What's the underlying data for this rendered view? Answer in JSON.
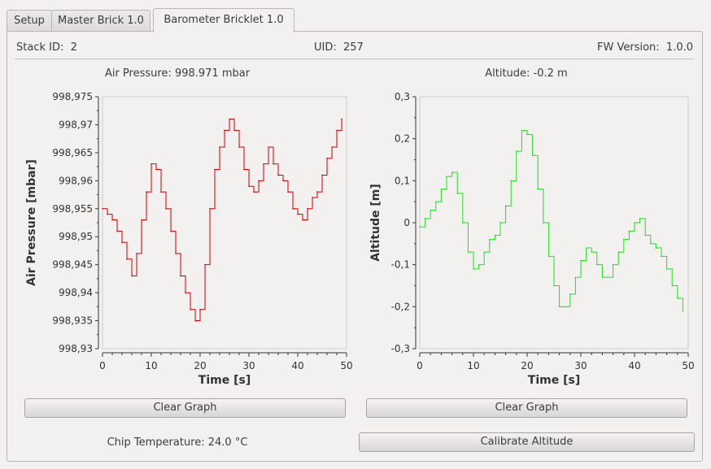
{
  "tabs": [
    {
      "label": "Setup",
      "active": false
    },
    {
      "label": "Master Brick 1.0",
      "active": false
    },
    {
      "label": "Barometer Bricklet 1.0",
      "active": true
    }
  ],
  "info": {
    "stack_id_label": "Stack ID:",
    "stack_id_value": "2",
    "uid_label": "UID:",
    "uid_value": "257",
    "fw_label": "FW Version:",
    "fw_value": "1.0.0"
  },
  "air_pressure_text": "Air Pressure: 998.971 mbar",
  "altitude_text": "Altitude: -0.2 m",
  "chip_temperature_text": "Chip Temperature: 24.0 °C",
  "buttons": {
    "clear_graph_left": "Clear Graph",
    "clear_graph_right": "Clear Graph",
    "calibrate_altitude": "Calibrate Altitude"
  },
  "chart_data": [
    {
      "type": "line",
      "ylabel": "Air Pressure [mbar]",
      "xlabel": "Time [s]",
      "xlim": [
        0,
        50
      ],
      "ylim": [
        998.93,
        998.975
      ],
      "xticks": [
        "0",
        "10",
        "20",
        "30",
        "40",
        "50"
      ],
      "yticks": [
        "998,93",
        "998,935",
        "998,94",
        "998,945",
        "998,95",
        "998,955",
        "998,96",
        "998,965",
        "998,97",
        "998,975"
      ],
      "grid": false,
      "color": "#cc0000",
      "series": [
        {
          "x": [
            0,
            1,
            2,
            3,
            4,
            5,
            6,
            7,
            8,
            9,
            10,
            11,
            12,
            13,
            14,
            15,
            16,
            17,
            18,
            19,
            20,
            21,
            22,
            23,
            24,
            25,
            26,
            27,
            28,
            29,
            30,
            31,
            32,
            33,
            34,
            35,
            36,
            37,
            38,
            39,
            40,
            41,
            42,
            43,
            44,
            45,
            46,
            47,
            48,
            49
          ],
          "values": [
            998.955,
            998.954,
            998.953,
            998.951,
            998.949,
            998.946,
            998.943,
            998.947,
            998.953,
            998.958,
            998.963,
            998.962,
            998.958,
            998.955,
            998.951,
            998.947,
            998.943,
            998.94,
            998.937,
            998.935,
            998.937,
            998.945,
            998.955,
            998.962,
            998.966,
            998.969,
            998.971,
            998.969,
            998.966,
            998.962,
            998.959,
            998.958,
            998.96,
            998.963,
            998.966,
            998.963,
            998.961,
            998.96,
            998.958,
            998.955,
            998.954,
            998.953,
            998.955,
            998.957,
            998.958,
            998.961,
            998.964,
            998.966,
            998.969,
            998.971
          ]
        }
      ]
    },
    {
      "type": "line",
      "ylabel": "Altitude [m]",
      "xlabel": "Time [s]",
      "xlim": [
        0,
        50
      ],
      "ylim": [
        -0.3,
        0.3
      ],
      "xticks": [
        "0",
        "10",
        "20",
        "30",
        "40",
        "50"
      ],
      "yticks": [
        "-0,3",
        "-0,2",
        "-0,1",
        "0",
        "0,1",
        "0,2",
        "0,3"
      ],
      "grid": false,
      "color": "#22dd22",
      "series": [
        {
          "x": [
            0,
            1,
            2,
            3,
            4,
            5,
            6,
            7,
            8,
            9,
            10,
            11,
            12,
            13,
            14,
            15,
            16,
            17,
            18,
            19,
            20,
            21,
            22,
            23,
            24,
            25,
            26,
            27,
            28,
            29,
            30,
            31,
            32,
            33,
            34,
            35,
            36,
            37,
            38,
            39,
            40,
            41,
            42,
            43,
            44,
            45,
            46,
            47,
            48,
            49
          ],
          "values": [
            -0.01,
            0.01,
            0.03,
            0.05,
            0.08,
            0.11,
            0.12,
            0.07,
            0.0,
            -0.07,
            -0.11,
            -0.1,
            -0.07,
            -0.04,
            -0.03,
            0.0,
            0.04,
            0.1,
            0.17,
            0.22,
            0.21,
            0.16,
            0.08,
            0.0,
            -0.08,
            -0.15,
            -0.2,
            -0.2,
            -0.17,
            -0.13,
            -0.09,
            -0.06,
            -0.07,
            -0.1,
            -0.13,
            -0.13,
            -0.1,
            -0.07,
            -0.04,
            -0.02,
            0.0,
            0.01,
            -0.03,
            -0.05,
            -0.06,
            -0.08,
            -0.11,
            -0.15,
            -0.18,
            -0.21
          ]
        }
      ]
    }
  ]
}
